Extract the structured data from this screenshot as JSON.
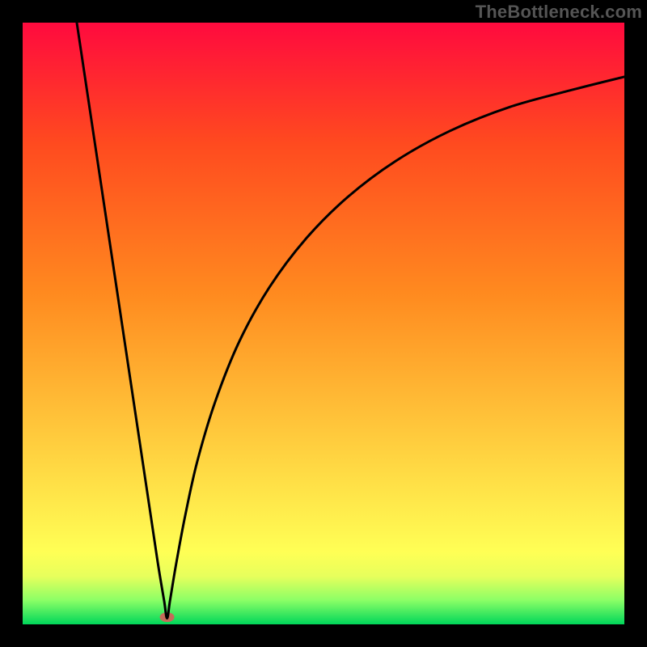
{
  "watermark": "TheBottleneck.com",
  "chart_data": {
    "type": "line",
    "title": "",
    "xlabel": "",
    "ylabel": "",
    "xlim": [
      0,
      100
    ],
    "ylim": [
      0,
      100
    ],
    "grid": false,
    "note": "No axis tick labels are visible; values are normalized 0–100 (percent of plot area). The curve sweeps from top-left down to a sharp minimum near x≈24, y≈0, then rises concavely toward the upper-right.",
    "background_gradient": {
      "stops": [
        {
          "offset": 0.0,
          "color": "#00d65a"
        },
        {
          "offset": 0.04,
          "color": "#8bff66"
        },
        {
          "offset": 0.08,
          "color": "#e7ff5c"
        },
        {
          "offset": 0.12,
          "color": "#ffff55"
        },
        {
          "offset": 0.55,
          "color": "#ff8a1f"
        },
        {
          "offset": 0.8,
          "color": "#ff4a1f"
        },
        {
          "offset": 1.0,
          "color": "#ff0a3e"
        }
      ]
    },
    "marker": {
      "x": 24,
      "y": 1.2,
      "color": "#c56b5a",
      "rx": 9,
      "ry": 6
    },
    "series": [
      {
        "name": "curve",
        "x": [
          9,
          12,
          15,
          18,
          21,
          22.5,
          23.5,
          24,
          24.5,
          25.5,
          27,
          29,
          32,
          36,
          41,
          47,
          54,
          62,
          71,
          81,
          92,
          100
        ],
        "y": [
          100,
          80,
          60,
          40,
          20,
          10,
          4,
          1,
          4,
          10,
          18,
          27,
          37,
          47,
          56,
          64,
          71,
          77,
          82,
          86,
          89,
          91
        ]
      }
    ]
  }
}
